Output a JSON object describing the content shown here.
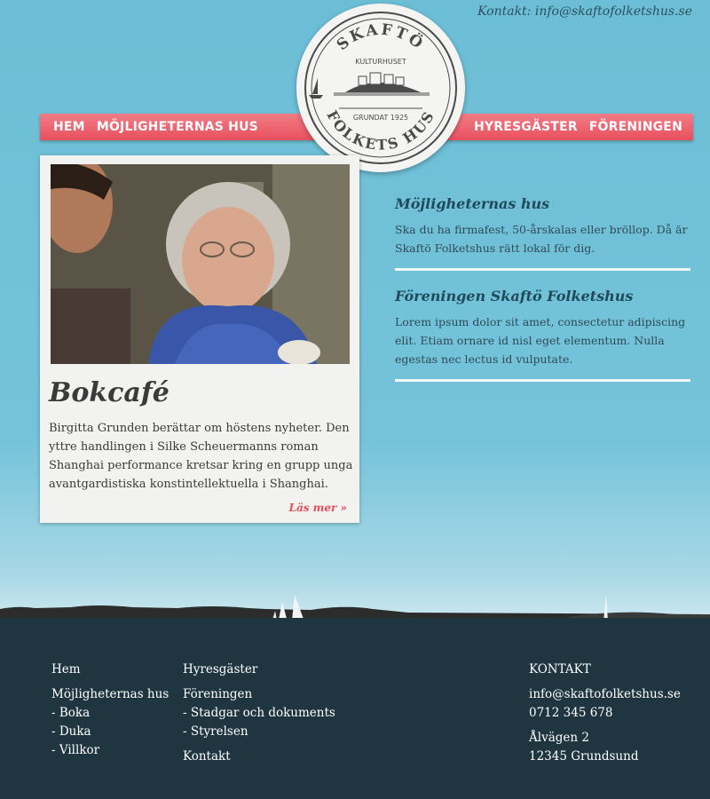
{
  "header": {
    "contact": "Kontakt: info@skaftofolketshus.se"
  },
  "nav": {
    "left": [
      "HEM",
      "MÖJLIGHETERNAS HUS"
    ],
    "right": [
      "HYRESGÄSTER",
      "FÖRENINGEN"
    ]
  },
  "logo": {
    "top": "SKAFTÖ",
    "sub": "KULTURHUSET",
    "founded": "GRUNDAT 1925",
    "bottom": "FOLKETS HUS"
  },
  "feature": {
    "title": "Bokcafé",
    "text": "Birgitta Grunden berättar om höstens nyheter.  Den yttre handlingen i Silke Scheuermanns roman Shanghai performance kretsar kring en grupp unga avantgardistiska konstintellektuella i Shanghai.",
    "more": "Läs mer »"
  },
  "articles": [
    {
      "title": "Möjligheternas hus",
      "text": "Ska du ha firmafest, 50-årskalas eller bröllop.  Då är Skaftö Folketshus rätt lokal för dig."
    },
    {
      "title": "Föreningen Skaftö Folketshus",
      "text": "Lorem ipsum dolor sit amet, consectetur adipiscing elit. Etiam ornare id nisl eget elementum. Nulla egestas nec lectus id vulputate."
    }
  ],
  "footer": {
    "col1": {
      "home": "Hem",
      "section": "Möjligheternas hus",
      "items": [
        "- Boka",
        "- Duka",
        "- Villkor"
      ]
    },
    "col2": {
      "tenants": "Hyresgäster",
      "assoc": "Föreningen",
      "items": [
        "- Stadgar och dokuments",
        "- Styrelsen"
      ],
      "contact": "Kontakt"
    },
    "col3": {
      "heading": "KONTAKT",
      "email": "info@skaftofolketshus.se",
      "phone": "0712 345 678",
      "street": "Ålvägen 2",
      "city": "12345 Grundsund"
    }
  },
  "colors": {
    "sky": "#74c3da",
    "ribbon": "#e8505e",
    "footer": "#1f3640",
    "heading": "#1f4a5a"
  }
}
